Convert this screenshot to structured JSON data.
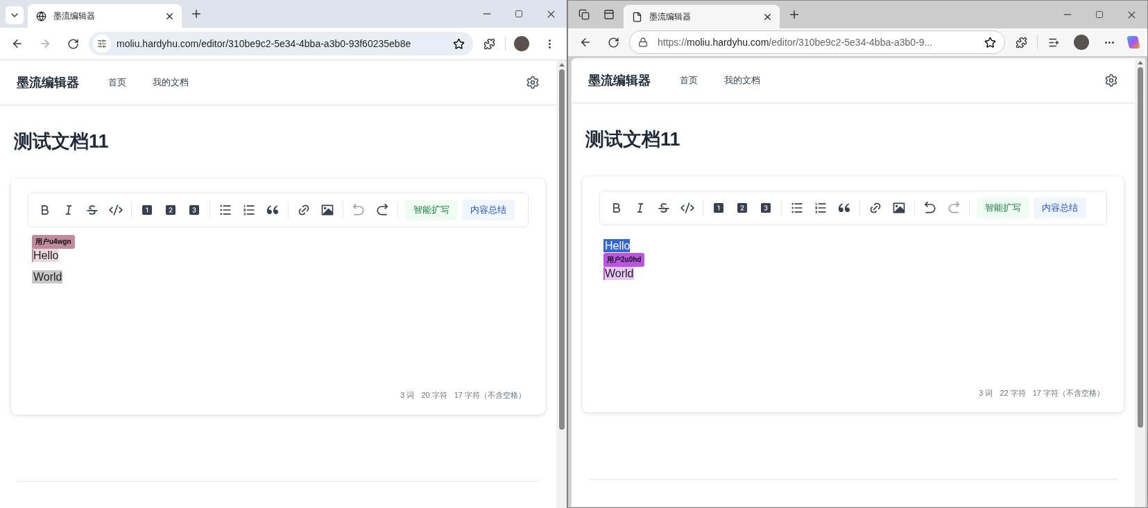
{
  "windows": [
    {
      "kind": "chrome",
      "focused": false,
      "tab_title": "墨流编辑器",
      "url": [
        {
          "text": "moliu.hardyhu.com/editor/310be9c2-5e34-4bba-a3b0-93f60235eb8e",
          "strong": true
        }
      ],
      "page": {
        "brand": "墨流编辑器",
        "nav": [
          {
            "label": "首页"
          },
          {
            "label": "我的文档"
          }
        ],
        "title": "测试文档11",
        "history": [
          {
            "kind": "undo",
            "disabled": true
          },
          {
            "kind": "redo",
            "disabled": false
          }
        ],
        "ai_buttons": [
          {
            "kind": "expand",
            "label": "智能扩写"
          },
          {
            "kind": "summary",
            "label": "内容总结"
          }
        ],
        "paragraphs": [
          {
            "text": "Hello",
            "selected": false,
            "collaborator": {
              "label": "用户u4wgn",
              "color": "#c08c9c"
            }
          },
          {
            "text": "World",
            "selected": true
          }
        ],
        "stats": [
          "3 词",
          "20 字符",
          "17 字符（不含空格）"
        ]
      }
    },
    {
      "kind": "edge",
      "focused": true,
      "tab_title": "墨流编辑器",
      "url": [
        {
          "text": "https://",
          "strong": false
        },
        {
          "text": "moliu.hardyhu.com",
          "strong": true
        },
        {
          "text": "/editor/310be9c2-5e34-4bba-a3b0-9...",
          "strong": false
        }
      ],
      "page": {
        "brand": "墨流编辑器",
        "nav": [
          {
            "label": "首页"
          },
          {
            "label": "我的文档"
          }
        ],
        "title": "测试文档11",
        "history": [
          {
            "kind": "undo",
            "disabled": false
          },
          {
            "kind": "redo",
            "disabled": true
          }
        ],
        "ai_buttons": [
          {
            "kind": "expand",
            "label": "智能扩写"
          },
          {
            "kind": "summary",
            "label": "内容总结"
          }
        ],
        "paragraphs": [
          {
            "text": "Hello",
            "selected": true
          },
          {
            "text": "World",
            "selected": false,
            "collaborator": {
              "label": "用户2u0hd",
              "color": "#b955e0"
            }
          }
        ],
        "stats": [
          "3 词",
          "22 字符",
          "17 字符（不含空格）"
        ]
      }
    }
  ]
}
